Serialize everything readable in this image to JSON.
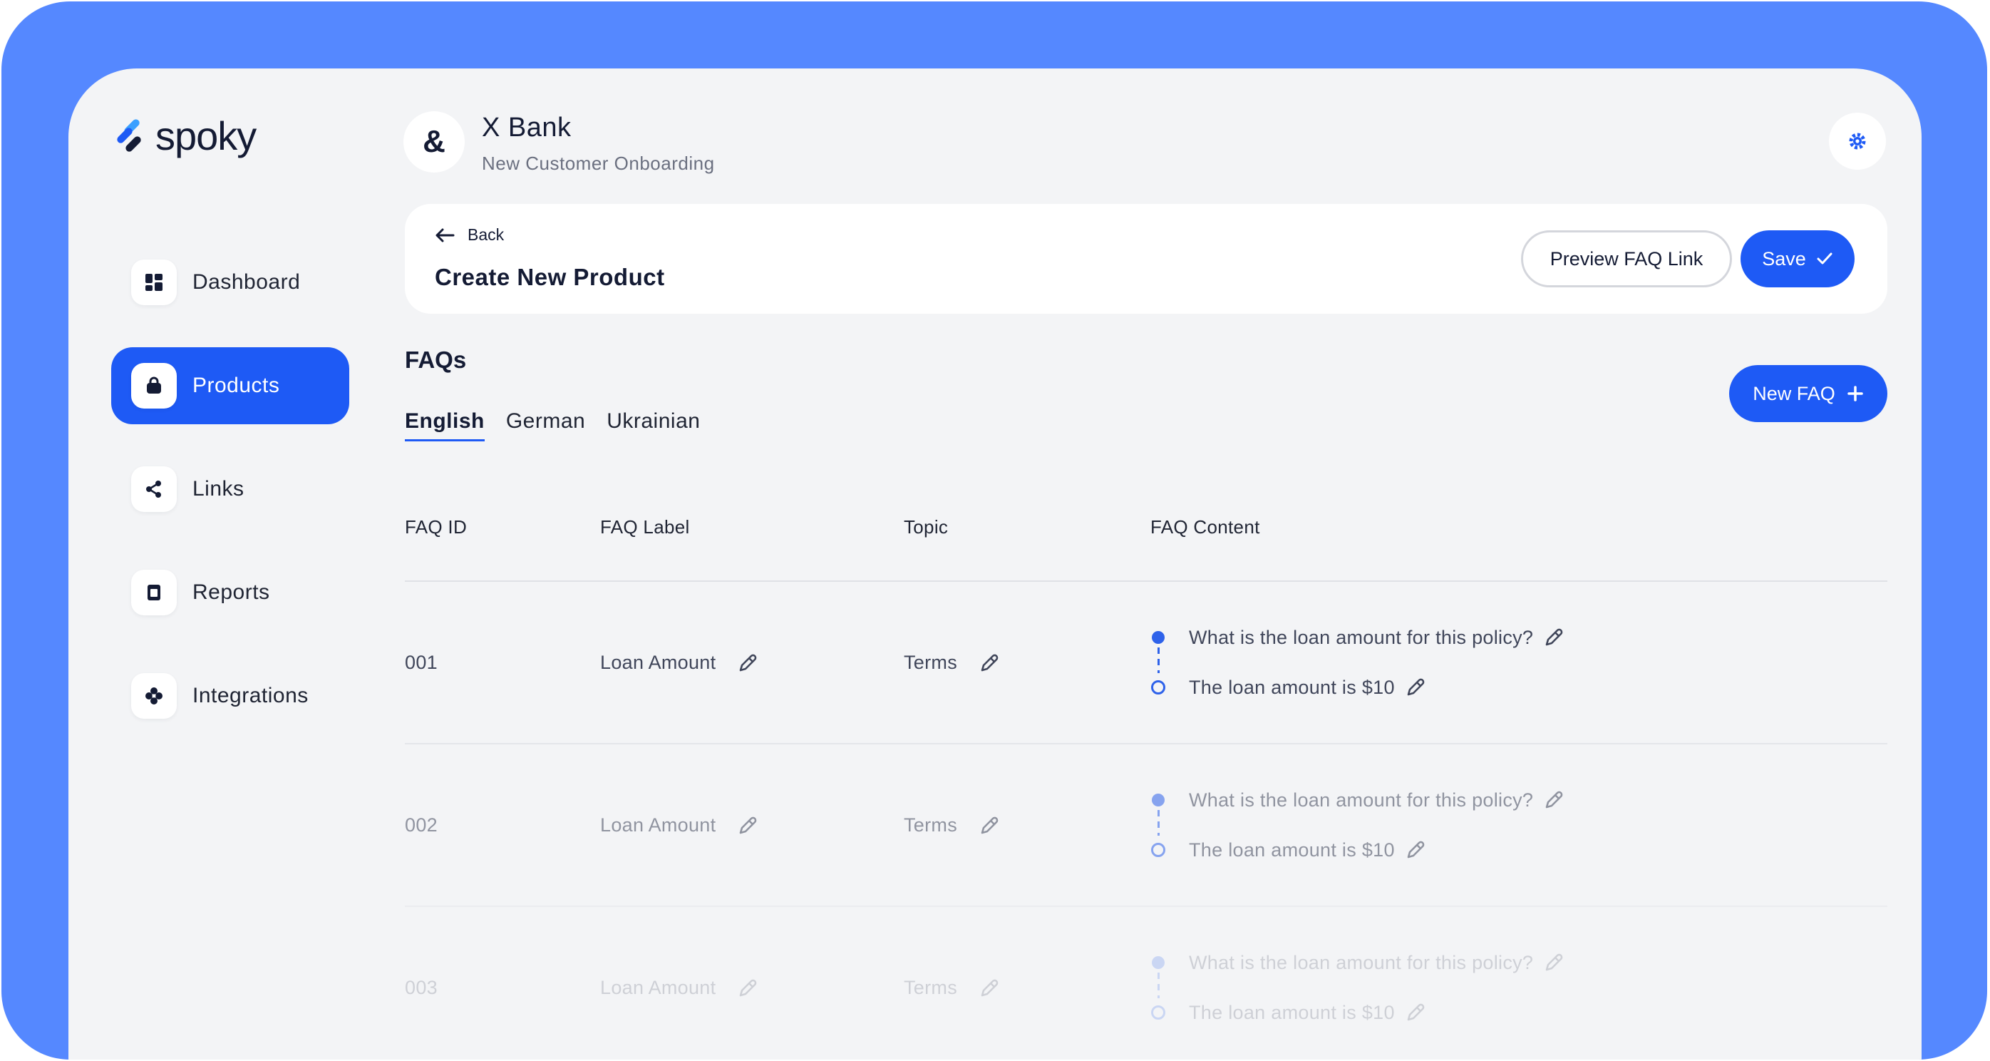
{
  "app": {
    "logo_text": "spoky",
    "colors": {
      "frame": "#5588ff",
      "accent": "#1e5af5",
      "danger": "#e8505b",
      "text": "#141b34"
    }
  },
  "sidebar": {
    "items": [
      {
        "label": "Dashboard",
        "icon": "dashboard-icon",
        "active": false
      },
      {
        "label": "Products",
        "icon": "bag-icon",
        "active": true
      },
      {
        "label": "Links",
        "icon": "share-icon",
        "active": false
      },
      {
        "label": "Reports",
        "icon": "report-icon",
        "active": false
      },
      {
        "label": "Integrations",
        "icon": "puzzle-icon",
        "active": false
      }
    ]
  },
  "header": {
    "avatar_glyph": "&",
    "org_name": "X Bank",
    "org_subtitle": "New Customer Onboarding",
    "settings_icon": "gear-icon"
  },
  "page": {
    "back_label": "Back",
    "title": "Create New Product",
    "preview_label": "Preview FAQ Link",
    "save_label": "Save"
  },
  "faq": {
    "section_title": "FAQs",
    "tabs": [
      "English",
      "German",
      "Ukrainian"
    ],
    "active_tab": "English",
    "new_faq_label": "New FAQ",
    "columns": [
      "FAQ ID",
      "FAQ Label",
      "Topic",
      "FAQ Content"
    ],
    "rows": [
      {
        "id": "001",
        "label": "Loan Amount",
        "topic": "Terms",
        "question": "What is the loan amount for this policy?",
        "answer": "The loan amount is $10",
        "opacity": 1
      },
      {
        "id": "002",
        "label": "Loan Amount",
        "topic": "Terms",
        "question": "What is the loan amount for this policy?",
        "answer": "The loan amount is $10",
        "opacity": 0.55
      },
      {
        "id": "003",
        "label": "Loan Amount",
        "topic": "Terms",
        "question": "What is the loan amount for this policy?",
        "answer": "The loan amount is $10",
        "opacity": 0.2
      }
    ]
  }
}
